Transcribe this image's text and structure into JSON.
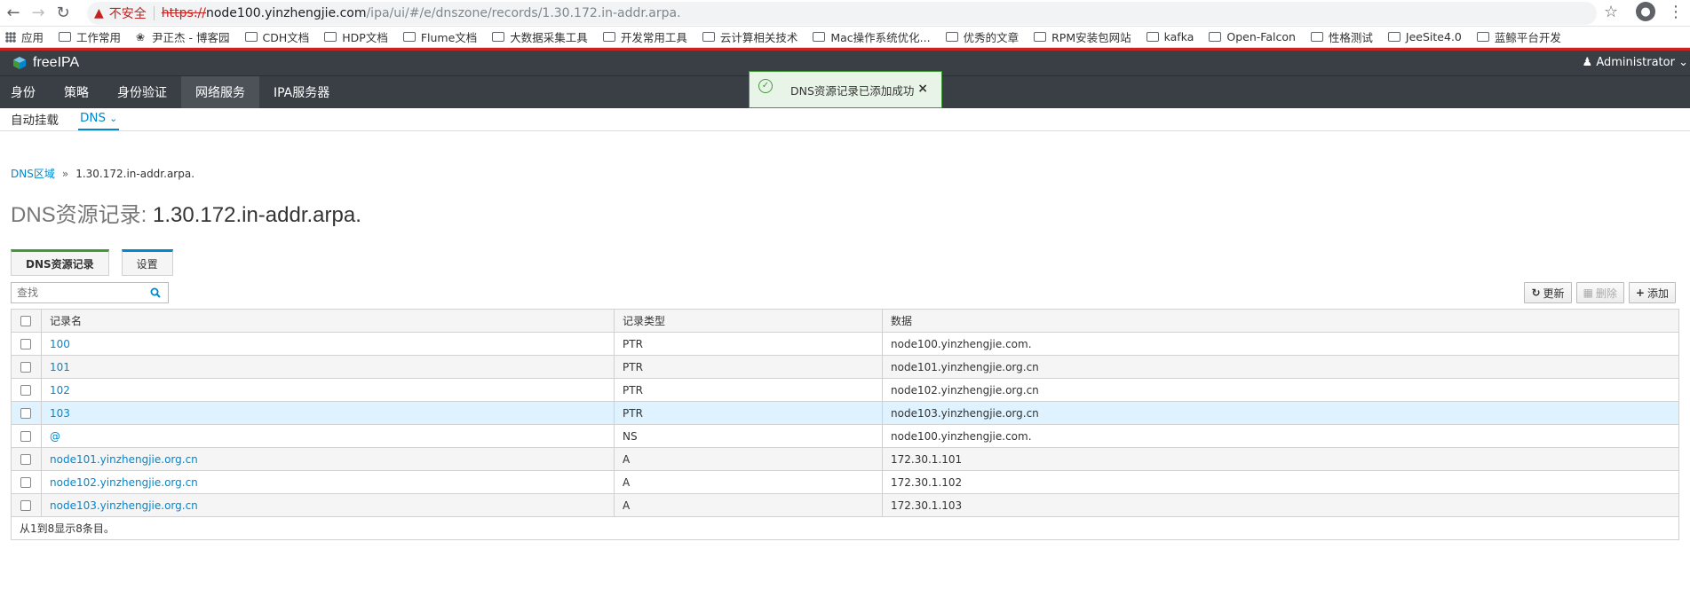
{
  "browser": {
    "insecure_label": "不安全",
    "url_scheme": "https://",
    "url_host": "node100.yinzhengjie.com",
    "url_path": "/ipa/ui/#/e/dnszone/records/1.30.172.in-addr.arpa.",
    "bookmarks": [
      {
        "label": "应用",
        "icon": "apps-grid-icon"
      },
      {
        "label": "工作常用",
        "icon": "folder-icon"
      },
      {
        "label": "尹正杰 - 博客园",
        "icon": "site-icon"
      },
      {
        "label": "CDH文档",
        "icon": "folder-icon"
      },
      {
        "label": "HDP文档",
        "icon": "folder-icon"
      },
      {
        "label": "Flume文档",
        "icon": "folder-icon"
      },
      {
        "label": "大数据采集工具",
        "icon": "folder-icon"
      },
      {
        "label": "开发常用工具",
        "icon": "folder-icon"
      },
      {
        "label": "云计算相关技术",
        "icon": "folder-icon"
      },
      {
        "label": "Mac操作系统优化...",
        "icon": "folder-icon"
      },
      {
        "label": "优秀的文章",
        "icon": "folder-icon"
      },
      {
        "label": "RPM安装包网站",
        "icon": "folder-icon"
      },
      {
        "label": "kafka",
        "icon": "folder-icon"
      },
      {
        "label": "Open-Falcon",
        "icon": "folder-icon"
      },
      {
        "label": "性格测试",
        "icon": "folder-icon"
      },
      {
        "label": "JeeSite4.0",
        "icon": "folder-icon"
      },
      {
        "label": "蓝鲸平台开发",
        "icon": "folder-icon"
      }
    ]
  },
  "header": {
    "logo_text": "freeIPA",
    "user_label": "Administrator"
  },
  "main_nav": [
    {
      "label": "身份",
      "active": false
    },
    {
      "label": "策略",
      "active": false
    },
    {
      "label": "身份验证",
      "active": false
    },
    {
      "label": "网络服务",
      "active": true
    },
    {
      "label": "IPA服务器",
      "active": false
    }
  ],
  "sub_nav": [
    {
      "label": "自动挂载",
      "active": false
    },
    {
      "label": "DNS",
      "active": true
    }
  ],
  "toast": {
    "message": "DNS资源记录已添加成功",
    "close": "×"
  },
  "breadcrumb": {
    "parent": "DNS区域",
    "separator": "»",
    "current": "1.30.172.in-addr.arpa."
  },
  "title": {
    "prefix": "DNS资源记录: ",
    "zone": "1.30.172.in-addr.arpa."
  },
  "tabs": [
    {
      "label": "DNS资源记录",
      "active": true
    },
    {
      "label": "设置",
      "active": false
    }
  ],
  "search": {
    "placeholder": "查找"
  },
  "actions": {
    "refresh": "更新",
    "delete": "删除",
    "add": "添加"
  },
  "table": {
    "columns": [
      "记录名",
      "记录类型",
      "数据"
    ],
    "rows": [
      {
        "name": "100",
        "type": "PTR",
        "data": "node100.yinzhengjie.com."
      },
      {
        "name": "101",
        "type": "PTR",
        "data": "node101.yinzhengjie.org.cn"
      },
      {
        "name": "102",
        "type": "PTR",
        "data": "node102.yinzhengjie.org.cn"
      },
      {
        "name": "103",
        "type": "PTR",
        "data": "node103.yinzhengjie.org.cn"
      },
      {
        "name": "@",
        "type": "NS",
        "data": "node100.yinzhengjie.com."
      },
      {
        "name": "node101.yinzhengjie.org.cn",
        "type": "A",
        "data": "172.30.1.101"
      },
      {
        "name": "node102.yinzhengjie.org.cn",
        "type": "A",
        "data": "172.30.1.102"
      },
      {
        "name": "node103.yinzhengjie.org.cn",
        "type": "A",
        "data": "172.30.1.103"
      }
    ],
    "footer": "从1到8显示8条目。"
  },
  "colors": {
    "accent": "#0088ce",
    "header_bg": "#393f45",
    "success": "#3f9c35",
    "insecure": "#c5221f"
  }
}
